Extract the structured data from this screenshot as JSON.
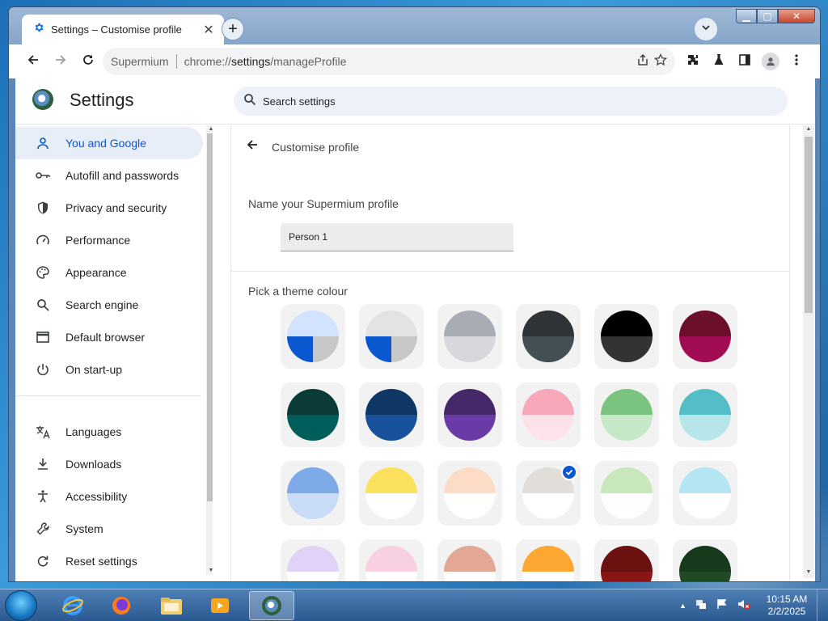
{
  "browser": {
    "tab_title": "Settings – Customise profile",
    "new_tab_symbol": "+",
    "omnibox_site": "Supermium",
    "omnibox_scheme": "chrome://",
    "omnibox_host": "settings",
    "omnibox_path": "/manageProfile"
  },
  "header": {
    "title": "Settings",
    "search_placeholder": "Search settings"
  },
  "sidebar": {
    "items": [
      {
        "label": "You and Google",
        "icon": "person-icon",
        "active": true
      },
      {
        "label": "Autofill and passwords",
        "icon": "key-icon"
      },
      {
        "label": "Privacy and security",
        "icon": "shield-icon"
      },
      {
        "label": "Performance",
        "icon": "speedometer-icon"
      },
      {
        "label": "Appearance",
        "icon": "palette-icon"
      },
      {
        "label": "Search engine",
        "icon": "search-icon"
      },
      {
        "label": "Default browser",
        "icon": "browser-window-icon"
      },
      {
        "label": "On start-up",
        "icon": "power-icon"
      },
      {
        "label": "Languages",
        "icon": "translate-icon"
      },
      {
        "label": "Downloads",
        "icon": "download-icon"
      },
      {
        "label": "Accessibility",
        "icon": "accessibility-icon"
      },
      {
        "label": "System",
        "icon": "wrench-icon"
      },
      {
        "label": "Reset settings",
        "icon": "reset-icon"
      }
    ]
  },
  "main": {
    "subpage_title": "Customise profile",
    "name_label": "Name your Supermium profile",
    "name_value": "Person 1",
    "theme_label": "Pick a theme colour",
    "swatches": [
      {
        "top": "#d3e3fd",
        "bl": "#0b57d0",
        "br": "#c7c7c7"
      },
      {
        "top": "#e3e3e3",
        "bl": "#0b57d0",
        "br": "#c7c7c7"
      },
      {
        "top": "#a8acb4",
        "bot": "#d6d8dc"
      },
      {
        "top": "#2e3337",
        "bot": "#434e55"
      },
      {
        "top": "#000000",
        "bot": "#333333"
      },
      {
        "top": "#6b0f2b",
        "bot": "#a10c52"
      },
      {
        "top": "#0a3b37",
        "bot": "#005e5a"
      },
      {
        "top": "#0e3766",
        "bot": "#17509b"
      },
      {
        "top": "#452868",
        "bot": "#6a3ba6"
      },
      {
        "top": "#f8a8b8",
        "bot": "#fde2ea"
      },
      {
        "top": "#7bc47f",
        "bot": "#c5e8c7"
      },
      {
        "top": "#53bec8",
        "bot": "#b7e6ea"
      },
      {
        "top": "#7eaae8",
        "bot": "#c8dcf7"
      },
      {
        "top": "#fce15c",
        "bot": "#ffffff"
      },
      {
        "top": "#fcdcc6",
        "bot": "#ffffff"
      },
      {
        "top": "#e2ddd8",
        "bot": "#ffffff",
        "selected": true
      },
      {
        "top": "#c8e8bb",
        "bot": "#ffffff"
      },
      {
        "top": "#b4e5f3",
        "bot": "#ffffff"
      },
      {
        "top": "#e1d2f7",
        "bot": "#ffffff"
      },
      {
        "top": "#f7d1e2",
        "bot": "#ffffff"
      },
      {
        "top": "#e2a894",
        "bot": "#ffffff"
      },
      {
        "top": "#fca833",
        "bot": "#ffffff"
      },
      {
        "top": "#6b1210",
        "bot": "#8a1515"
      },
      {
        "top": "#183a1c",
        "bot": "#1f4a24"
      }
    ]
  },
  "taskbar": {
    "time": "10:15 AM",
    "date": "2/2/2025"
  },
  "colors": {
    "accent": "#0b57d0",
    "active_nav_bg": "#e8eef8",
    "search_bg": "#edf2fa"
  }
}
